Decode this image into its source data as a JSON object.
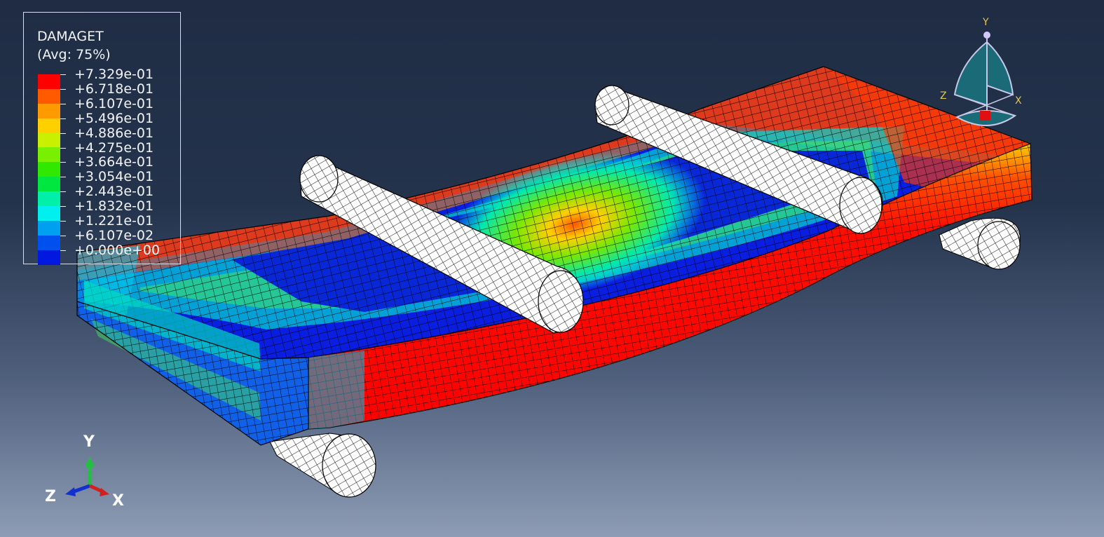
{
  "legend": {
    "title": "DAMAGET",
    "subtitle": "(Avg: 75%)",
    "entries": [
      {
        "label": "+7.329e-01",
        "color": "#ff0000"
      },
      {
        "label": "+6.718e-01",
        "color": "#ff5a00"
      },
      {
        "label": "+6.107e-01",
        "color": "#ff9a00"
      },
      {
        "label": "+5.496e-01",
        "color": "#ffcf00"
      },
      {
        "label": "+4.886e-01",
        "color": "#c8f000"
      },
      {
        "label": "+4.275e-01",
        "color": "#78f000"
      },
      {
        "label": "+3.664e-01",
        "color": "#30e800"
      },
      {
        "label": "+3.054e-01",
        "color": "#00e840"
      },
      {
        "label": "+2.443e-01",
        "color": "#00f0a8"
      },
      {
        "label": "+1.832e-01",
        "color": "#00f0f0"
      },
      {
        "label": "+1.221e-01",
        "color": "#00a0f0"
      },
      {
        "label": "+6.107e-02",
        "color": "#0050f0"
      },
      {
        "label": "+0.000e+00",
        "color": "#0018e0"
      }
    ]
  },
  "triad": {
    "x": "X",
    "y": "Y",
    "z": "Z"
  },
  "view_cube": {
    "x": "X",
    "y": "Y",
    "z": "Z"
  },
  "colors": {
    "background_top": "#1f2c44",
    "background_bottom": "#8e9cb5",
    "mesh_line": "#000000",
    "roller_fill": "#ffffff"
  }
}
